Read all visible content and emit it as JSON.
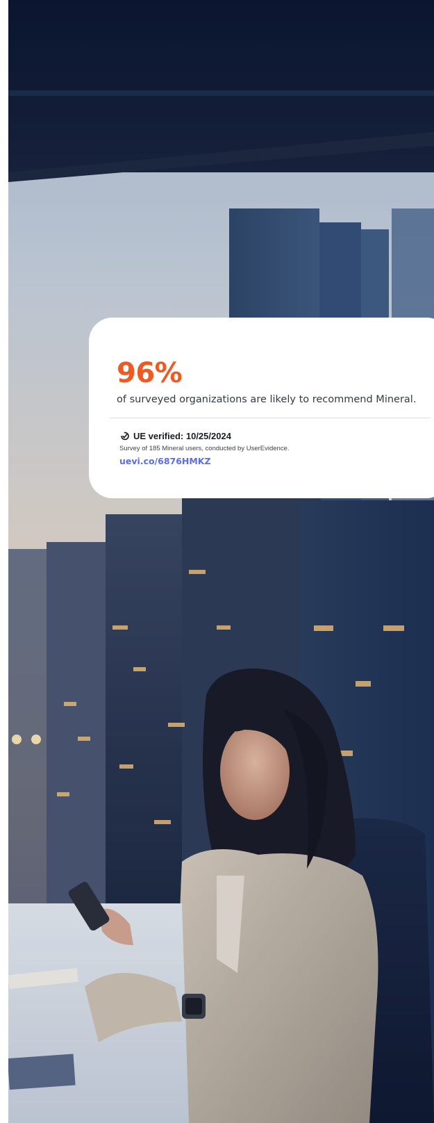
{
  "hero": {
    "image": "woman-using-phone-at-desk-city-night-photo"
  },
  "stat_card": {
    "value": "96%",
    "description": "of surveyed organizations are likely to recommend Mineral.",
    "verification": {
      "icon": "check-verified-icon",
      "label": "UE verified: 10/25/2024",
      "note": "Survey of 185 Mineral users, conducted by UserEvidence.",
      "link_text": "uevi.co/6876HMKZ"
    }
  },
  "colors": {
    "accent": "#ee5a24",
    "link": "#5b6cf0",
    "card_bg": "#ffffff",
    "sky_top": "#0e1c3a",
    "sunset": "#f6c48a"
  }
}
